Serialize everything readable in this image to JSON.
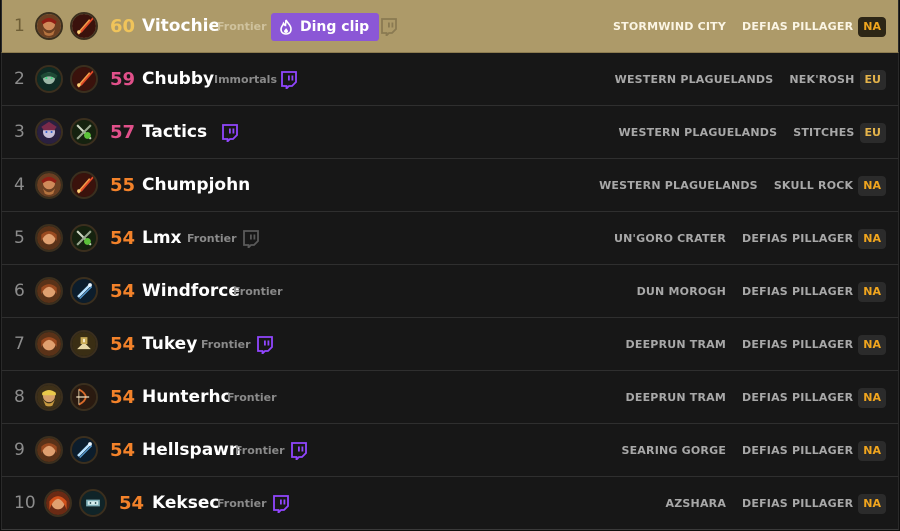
{
  "colors": {
    "highlight_bg": "#ad9a69",
    "row_bg": "#171717",
    "level_60": "#f0c45a",
    "level_high": "#e0508a",
    "level_mid": "#f3822a",
    "twitch_purple": "#9146ff",
    "ding_button": "#8b57d6",
    "region_text": "#f0a51e"
  },
  "rows": [
    {
      "rank": "1",
      "level": "60",
      "name": "Vitochie",
      "guild": "Frontier",
      "ding_label": "Ding clip",
      "twitch": "twitch-icon-muted",
      "zone": "STORMWIND CITY",
      "realm": "DEFIAS PILLAGER",
      "region": "NA"
    },
    {
      "rank": "2",
      "level": "59",
      "name": "Chubby",
      "guild": "Immortals",
      "twitch": "twitch-icon",
      "zone": "WESTERN PLAGUELANDS",
      "realm": "NEK'ROSH",
      "region": "EU"
    },
    {
      "rank": "3",
      "level": "57",
      "name": "Tactics",
      "guild": "",
      "twitch": "twitch-icon",
      "zone": "WESTERN PLAGUELANDS",
      "realm": "STITCHES",
      "region": "EU"
    },
    {
      "rank": "4",
      "level": "55",
      "name": "Chumpjohn",
      "guild": "",
      "twitch": "",
      "zone": "WESTERN PLAGUELANDS",
      "realm": "SKULL ROCK",
      "region": "NA"
    },
    {
      "rank": "5",
      "level": "54",
      "name": "Lmx",
      "guild": "Frontier",
      "twitch": "twitch-icon-muted",
      "zone": "UN'GORO CRATER",
      "realm": "DEFIAS PILLAGER",
      "region": "NA"
    },
    {
      "rank": "6",
      "level": "54",
      "name": "Windforce",
      "guild": "Frontier",
      "twitch": "",
      "zone": "DUN MOROGH",
      "realm": "DEFIAS PILLAGER",
      "region": "NA"
    },
    {
      "rank": "7",
      "level": "54",
      "name": "Tukey",
      "guild": "Frontier",
      "twitch": "twitch-icon",
      "zone": "DEEPRUN TRAM",
      "realm": "DEFIAS PILLAGER",
      "region": "NA"
    },
    {
      "rank": "8",
      "level": "54",
      "name": "Hunterhc",
      "guild": "Frontier",
      "twitch": "",
      "zone": "DEEPRUN TRAM",
      "realm": "DEFIAS PILLAGER",
      "region": "NA"
    },
    {
      "rank": "9",
      "level": "54",
      "name": "Hellspawn",
      "guild": "Frontier",
      "twitch": "twitch-icon",
      "zone": "SEARING GORGE",
      "realm": "DEFIAS PILLAGER",
      "region": "NA"
    },
    {
      "rank": "10",
      "level": "54",
      "name": "Keksec",
      "guild": "Frontier",
      "twitch": "twitch-icon",
      "zone": "AZSHARA",
      "realm": "DEFIAS PILLAGER",
      "region": "NA"
    }
  ]
}
